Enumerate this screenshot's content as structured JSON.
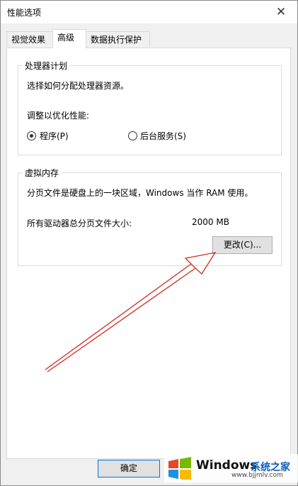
{
  "window": {
    "title": "性能选项",
    "close_glyph": "✕"
  },
  "tabs": [
    {
      "label": "视觉效果",
      "active": false
    },
    {
      "label": "高级",
      "active": true
    },
    {
      "label": "数据执行保护",
      "active": false
    }
  ],
  "processor": {
    "legend": "处理器计划",
    "description": "选择如何分配处理器资源。",
    "adjust_label": "调整以优化性能:",
    "options": [
      {
        "label": "程序(P)",
        "selected": true
      },
      {
        "label": "后台服务(S)",
        "selected": false
      }
    ]
  },
  "virtual_memory": {
    "legend": "虚拟内存",
    "description": "分页文件是硬盘上的一块区域，Windows 当作 RAM 使用。",
    "total_label": "所有驱动器总分页文件大小:",
    "total_value": "2000 MB",
    "change_button": "更改(C)..."
  },
  "footer": {
    "ok_button": "确定"
  },
  "watermark": {
    "brand": "Windows",
    "brand_cn": "系统之家",
    "url": "www.bjjmlv.com"
  },
  "colors": {
    "arrow": "#d42a20",
    "focus_border": "#0078d7"
  }
}
